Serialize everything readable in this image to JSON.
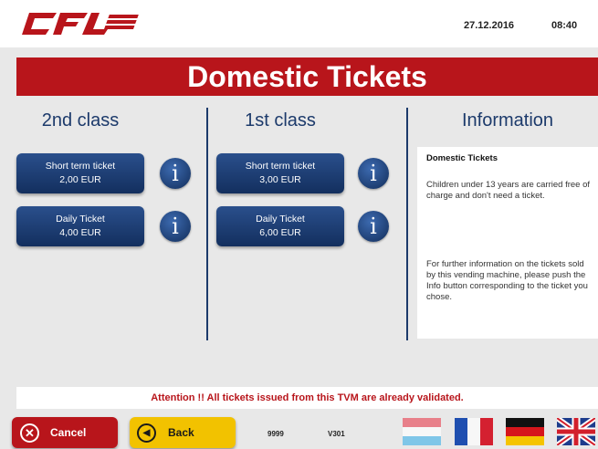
{
  "header": {
    "logo_text": "CFL",
    "date": "27.12.2016",
    "time": "08:40"
  },
  "title": "Domestic Tickets",
  "columns": {
    "second_class": {
      "heading": "2nd class",
      "tickets": [
        {
          "name": "Short term ticket",
          "price": "2,00 EUR"
        },
        {
          "name": "Daily Ticket",
          "price": "4,00 EUR"
        }
      ]
    },
    "first_class": {
      "heading": "1st class",
      "tickets": [
        {
          "name": "Short term ticket",
          "price": "3,00 EUR"
        },
        {
          "name": "Daily Ticket",
          "price": "6,00 EUR"
        }
      ]
    },
    "information": {
      "heading": "Information",
      "panel_title": "Domestic Tickets",
      "paragraph1": "Children under 13 years are carried free of charge and don't need a ticket.",
      "paragraph2": "For further information on the tickets sold by this vending machine, please push the Info button corresponding to the ticket you chose."
    }
  },
  "info_button_glyph": "i",
  "attention": "Attention !! All tickets issued from this TVM are already validated.",
  "footer": {
    "cancel_label": "Cancel",
    "back_label": "Back",
    "code1": "9999",
    "code2": "V301",
    "languages": [
      "Luxembourgish",
      "French",
      "German",
      "English"
    ]
  },
  "colors": {
    "brand_red": "#b8151b",
    "button_blue": "#1c3a6b",
    "back_yellow": "#f2c200"
  }
}
